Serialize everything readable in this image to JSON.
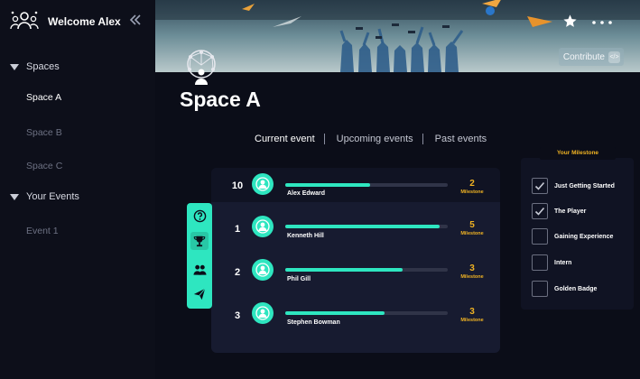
{
  "sidebar": {
    "welcome": "Welcome Alex",
    "collapse_icon": "double-chevron-left-icon",
    "sections": [
      {
        "label": "Spaces",
        "items": [
          "Space A",
          "Space B",
          "Space C"
        ]
      },
      {
        "label": "Your  Events",
        "items": [
          "Event 1"
        ]
      }
    ],
    "active_item": "Space A"
  },
  "banner": {
    "contribute_label": "Contribute",
    "star_icon": "star-icon",
    "more_icon": "more-horizontal-icon"
  },
  "space": {
    "title": "Space A"
  },
  "tabs": [
    "Current event",
    "Upcoming events",
    "Past events"
  ],
  "leaderboard": {
    "milestone_label": "Milestone",
    "rows": [
      {
        "rank": "10",
        "name": "Alex Edward",
        "progress": 0.52,
        "milestones": "2"
      },
      {
        "rank": "1",
        "name": "Kenneth Hill",
        "progress": 0.95,
        "milestones": "5"
      },
      {
        "rank": "2",
        "name": "Phil Gill",
        "progress": 0.72,
        "milestones": "3"
      },
      {
        "rank": "3",
        "name": "Stephen Bowman",
        "progress": 0.61,
        "milestones": "3"
      }
    ]
  },
  "toolbar": {
    "tools": [
      "help-icon",
      "trophy-icon",
      "group-icon",
      "send-icon"
    ],
    "active": "trophy-icon"
  },
  "milestones": {
    "title": "Your Milestone",
    "items": [
      {
        "label": "Just Getting Started",
        "checked": true
      },
      {
        "label": "The Player",
        "checked": true
      },
      {
        "label": "Gaining Experience",
        "checked": false
      },
      {
        "label": "Intern",
        "checked": false
      },
      {
        "label": "Golden Badge",
        "checked": false
      }
    ]
  },
  "colors": {
    "accent": "#2ee6c0",
    "milestone": "#f0b323",
    "background": "#0b0d18",
    "panel": "#171b30"
  }
}
